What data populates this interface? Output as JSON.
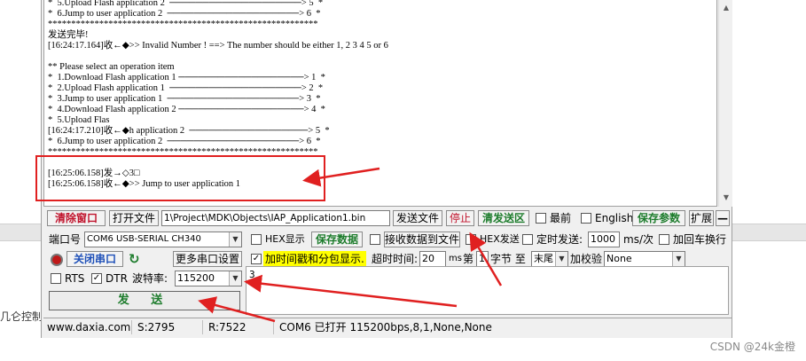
{
  "receive": {
    "lines": [
      "*  5.Upload Flash application 2  ────────────────────> 5  *",
      "*  6.Jump to user application 2  ────────────────────> 6  *",
      "**********************************************************",
      "发送完毕!",
      "[16:24:17.164]收←◆>> Invalid Number ! ==> The number should be either 1, 2 3 4 5 or 6",
      "",
      "** Please select an operation item",
      "*  1.Download Flash application 1 ───────────────────> 1  *",
      "*  2.Upload Flash application 1  ────────────────────> 2  *",
      "*  3.Jump to user application 1  ────────────────────> 3  *",
      "*  4.Download Flash application 2 ───────────────────> 4  *",
      "*  5.Upload Flas",
      "[16:24:17.210]收←◆h application 2  ──────────────────> 5  *",
      "*  6.Jump to user application 2  ────────────────────> 6  *",
      "**********************************************************",
      "",
      "[16:25:06.158]发→◇3□",
      "[16:25:06.158]收←◆>> Jump to user application 1"
    ]
  },
  "toolbar1": {
    "clear_window": "清除窗口",
    "open_file": "打开文件",
    "file_path": "1\\Project\\MDK\\Objects\\IAP_Application1.bin",
    "send_file": "发送文件",
    "stop": "停止",
    "clear_send": "清发送区",
    "topmost": "最前",
    "english": "English",
    "save_params": "保存参数",
    "expand": "扩展",
    "collapse": "—"
  },
  "toolbar2": {
    "port_label": "端口号",
    "port_value": "COM6 USB-SERIAL CH340",
    "hex_display": "HEX显示",
    "save_data": "保存数据",
    "recv_to_file": "接收数据到文件",
    "hex_send": "HEX发送",
    "timed_send": "定时发送:",
    "interval": "1000",
    "interval_unit": "ms/次",
    "add_crlf": "加回车换行"
  },
  "toolbar3": {
    "close_port": "关闭串口",
    "more_settings": "更多串口设置",
    "timestamp": "加时间戳和分包显示.",
    "timeout_label": "超时时间:",
    "timeout": "20",
    "timeout_unit": "ms",
    "nth_label": "第",
    "nth": "1",
    "byte_label": "字节 至",
    "end_value": "末尾",
    "checksum_label": "加校验",
    "checksum_value": "None"
  },
  "toolbar4": {
    "rts": "RTS",
    "dtr": "DTR",
    "baud_label": "波特率:",
    "baud_value": "115200"
  },
  "send": {
    "text": "3",
    "button": "发 送"
  },
  "status": {
    "site": "www.daxia.com",
    "sent": "S:2795",
    "received": "R:7522",
    "port_info": "COM6 已打开  115200bps,8,1,None,None"
  },
  "page": {
    "left_snippet": "几仑控制",
    "watermark": "CSDN @24k金橙"
  },
  "colors": {
    "annotation_red": "#e02020",
    "highlight_yellow": "#ffff00",
    "accent_green": "#1d7c2c"
  }
}
